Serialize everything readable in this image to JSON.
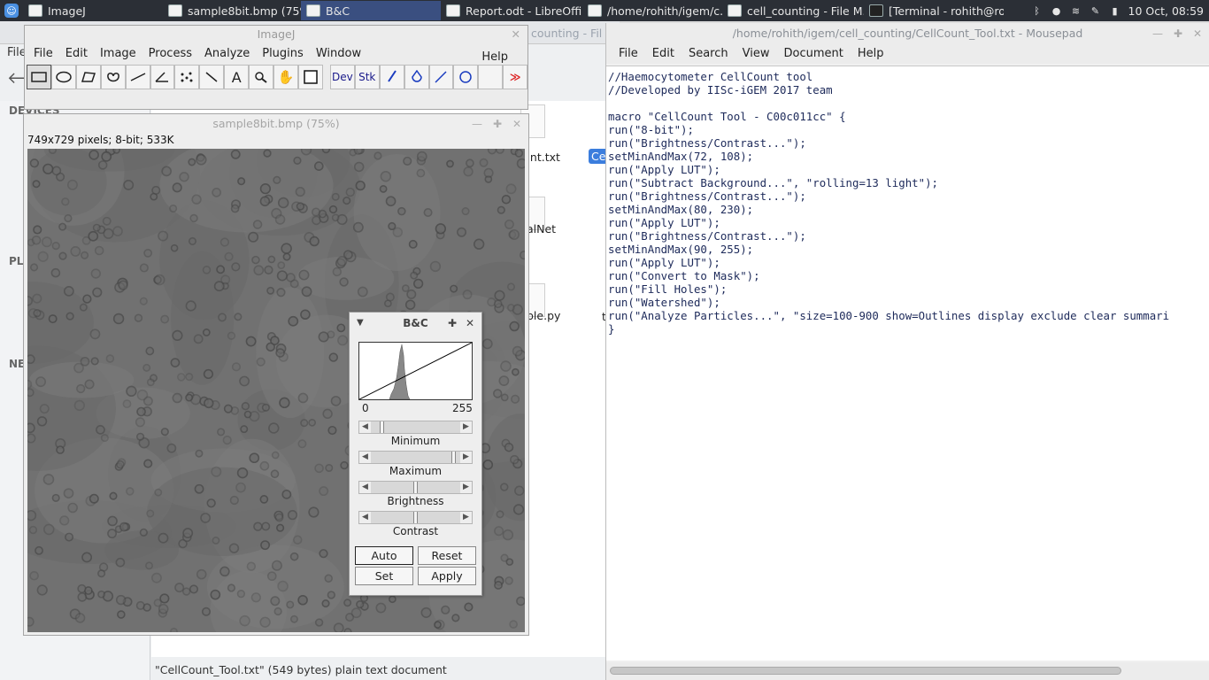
{
  "taskbar": {
    "tasks": [
      "ImageJ",
      "sample8bit.bmp (75%)",
      "B&C",
      "Report.odt - LibreOffi...",
      "/home/rohith/igem/c...",
      "cell_counting - File M...",
      "[Terminal - rohith@ro..."
    ],
    "clock": "10 Oct, 08:59"
  },
  "filemanager": {
    "title_fragment": "counting - Fil",
    "menu_file": "File",
    "sections": [
      "DEVICES",
      "PLA",
      "NE"
    ],
    "files": [
      "unt.txt",
      "Ce",
      "alNet",
      "t",
      "ple.py"
    ],
    "status": "\"CellCount_Tool.txt\" (549 bytes) plain text document"
  },
  "mousepad": {
    "title": "/home/rohith/igem/cell_counting/CellCount_Tool.txt - Mousepad",
    "menu": [
      "File",
      "Edit",
      "Search",
      "View",
      "Document",
      "Help"
    ],
    "code": "//Haemocytometer CellCount tool\n//Developed by IISc-iGEM 2017 team\n\nmacro \"CellCount Tool - C00c011cc\" {\nrun(\"8-bit\");\nrun(\"Brightness/Contrast...\");\nsetMinAndMax(72, 108);\nrun(\"Apply LUT\");\nrun(\"Subtract Background...\", \"rolling=13 light\");\nrun(\"Brightness/Contrast...\");\nsetMinAndMax(80, 230);\nrun(\"Apply LUT\");\nrun(\"Brightness/Contrast...\");\nsetMinAndMax(90, 255);\nrun(\"Apply LUT\");\nrun(\"Convert to Mask\");\nrun(\"Fill Holes\");\nrun(\"Watershed\");\nrun(\"Analyze Particles...\", \"size=100-900 show=Outlines display exclude clear summari\n}"
  },
  "imagej": {
    "title": "ImageJ",
    "menu": [
      "File",
      "Edit",
      "Image",
      "Process",
      "Analyze",
      "Plugins",
      "Window"
    ],
    "help": "Help",
    "tools": [
      "rectangle-tool",
      "oval-tool",
      "polygon-tool",
      "freehand-tool",
      "line-tool",
      "angle-tool",
      "multipoint-tool",
      "wand-tool",
      "text-tool",
      "zoom-tool",
      "hand-tool",
      "color-picker-tool"
    ],
    "tool_dev": "Dev",
    "tool_stk": "Stk",
    "more": "≫"
  },
  "image_window": {
    "title": "sample8bit.bmp (75%)",
    "info": "749x729 pixels; 8-bit; 533K"
  },
  "bc": {
    "title": "B&C",
    "min_label": "0",
    "max_label": "255",
    "sliders": [
      "Minimum",
      "Maximum",
      "Brightness",
      "Contrast"
    ],
    "minimum": 0.1,
    "maximum": 0.95,
    "brightness": 0.5,
    "contrast": 0.5,
    "buttons": {
      "auto": "Auto",
      "reset": "Reset",
      "set": "Set",
      "apply": "Apply"
    }
  }
}
